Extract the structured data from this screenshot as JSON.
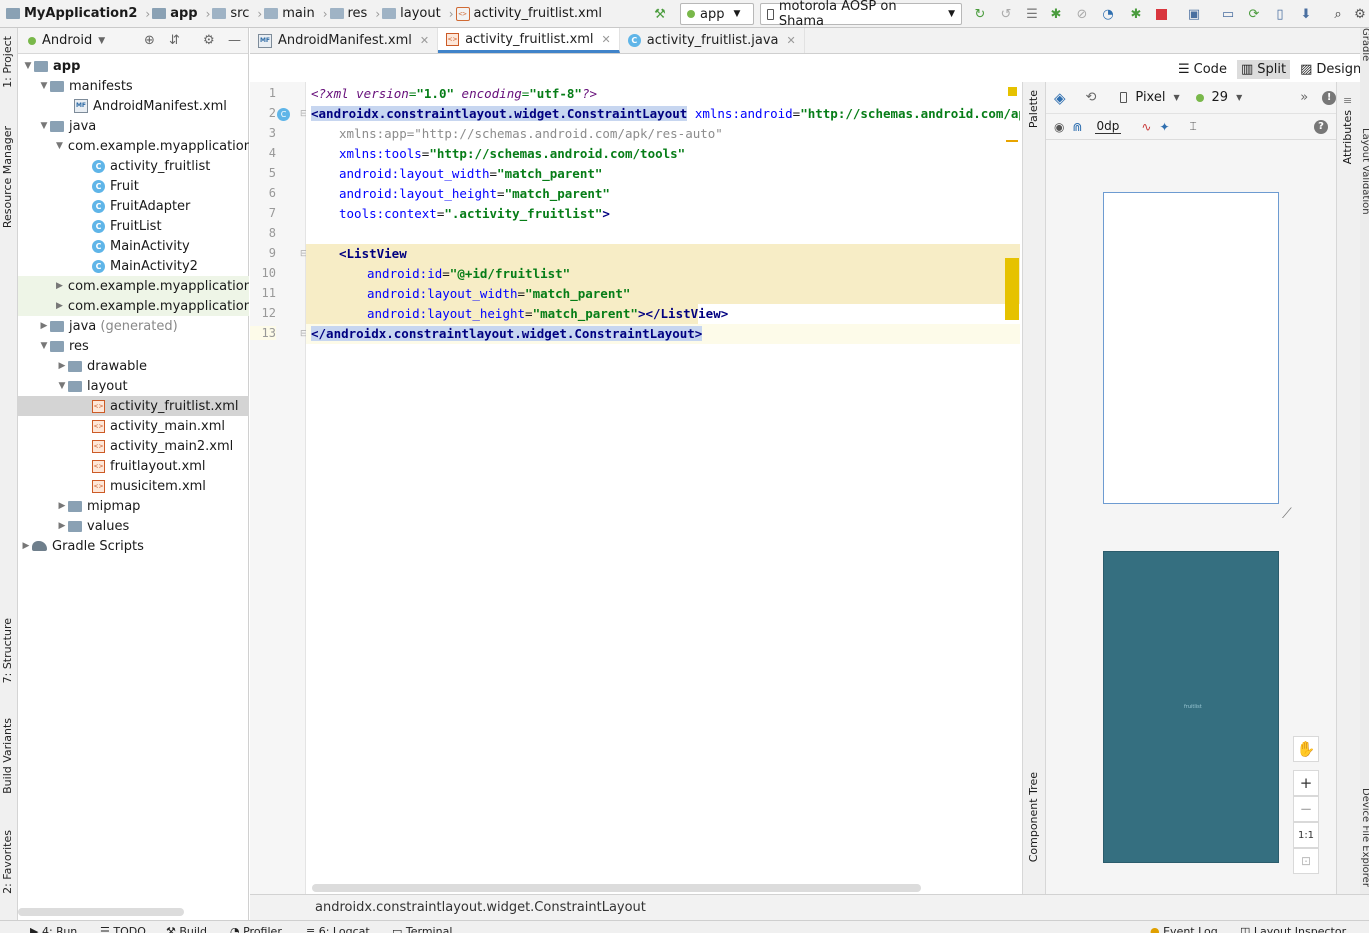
{
  "breadcrumbs": [
    "MyApplication2",
    "app",
    "src",
    "main",
    "res",
    "layout",
    "activity_fruitlist.xml"
  ],
  "toolbar": {
    "run_config": "app",
    "device": "motorola AOSP on Shama"
  },
  "left_tool_tabs": [
    "1: Project",
    "Resource Manager",
    "7: Structure",
    "Build Variants",
    "2: Favorites"
  ],
  "project": {
    "view_mode": "Android",
    "tree": [
      {
        "label": "app",
        "bold": true
      },
      {
        "label": "manifests"
      },
      {
        "label": "AndroidManifest.xml"
      },
      {
        "label": "java"
      },
      {
        "label": "com.example.myapplication"
      },
      {
        "label": "activity_fruitlist"
      },
      {
        "label": "Fruit"
      },
      {
        "label": "FruitAdapter"
      },
      {
        "label": "FruitList"
      },
      {
        "label": "MainActivity"
      },
      {
        "label": "MainActivity2"
      },
      {
        "label": "com.example.myapplication"
      },
      {
        "label": "com.example.myapplication"
      },
      {
        "label": "java",
        "suffix": "(generated)"
      },
      {
        "label": "res"
      },
      {
        "label": "drawable"
      },
      {
        "label": "layout"
      },
      {
        "label": "activity_fruitlist.xml"
      },
      {
        "label": "activity_main.xml"
      },
      {
        "label": "activity_main2.xml"
      },
      {
        "label": "fruitlayout.xml"
      },
      {
        "label": "musicitem.xml"
      },
      {
        "label": "mipmap"
      },
      {
        "label": "values"
      },
      {
        "label": "Gradle Scripts"
      }
    ]
  },
  "tabs": [
    {
      "label": "AndroidManifest.xml"
    },
    {
      "label": "activity_fruitlist.xml"
    },
    {
      "label": "activity_fruitlist.java"
    }
  ],
  "view_modes": [
    "Code",
    "Split",
    "Design"
  ],
  "editor": {
    "line_numbers": [
      "1",
      "2",
      "3",
      "4",
      "5",
      "6",
      "7",
      "8",
      "9",
      "10",
      "11",
      "12",
      "13"
    ]
  },
  "code": {
    "l1": {
      "a": "<?xml ",
      "b": "version",
      "c": "=",
      "d": "\"1.0\"",
      "e": " encoding",
      "f": "=",
      "g": "\"utf-8\"",
      "h": "?>"
    },
    "l2": {
      "tag": "<androidx.constraintlayout.widget.ConstraintLayout",
      "attr": " xmlns:android",
      "eq": "=",
      "val": "\"http://schemas.android.com/apk/res/android\""
    },
    "l3": {
      "attr": "xmlns:app",
      "eq": "=",
      "val": "\"http://schemas.android.com/apk/res-auto\""
    },
    "l4": {
      "attr": "xmlns:tools",
      "eq": "=",
      "val": "\"http://schemas.android.com/tools\""
    },
    "l5": {
      "attr": "android:layout_width",
      "eq": "=",
      "val": "\"match_parent\""
    },
    "l6": {
      "attr": "android:layout_height",
      "eq": "=",
      "val": "\"match_parent\""
    },
    "l7": {
      "attr": "tools:context",
      "eq": "=",
      "val": "\".activity_fruitlist\"",
      "end": ">"
    },
    "l9": {
      "tag": "<ListView"
    },
    "l10": {
      "attr": "android:id",
      "eq": "=",
      "val": "\"@+id/fruitlist\""
    },
    "l11": {
      "attr": "android:layout_width",
      "eq": "=",
      "val": "\"match_parent\""
    },
    "l12": {
      "attr": "android:layout_height",
      "eq": "=",
      "val": "\"match_parent\"",
      "end": "></ListView>"
    },
    "l13": {
      "tag": "</androidx.constraintlayout.widget.ConstraintLayout>"
    }
  },
  "design": {
    "device": "Pixel",
    "api": "29",
    "margin": "0dp",
    "palette_label": "Palette",
    "component_tree_label": "Component Tree",
    "attributes_label": "Attributes",
    "preview_text": "fruitlist",
    "zoom_reset": "1:1"
  },
  "right_tool_tabs": [
    "Gradle",
    "Layout Validation",
    "Device File Explorer"
  ],
  "status": {
    "path": "androidx.constraintlayout.widget.ConstraintLayout"
  },
  "bottom_tabs": [
    "4: Run",
    "TODO",
    "Build",
    "Profiler",
    "6: Logcat",
    "Terminal",
    "Event Log",
    "Layout Inspector"
  ]
}
